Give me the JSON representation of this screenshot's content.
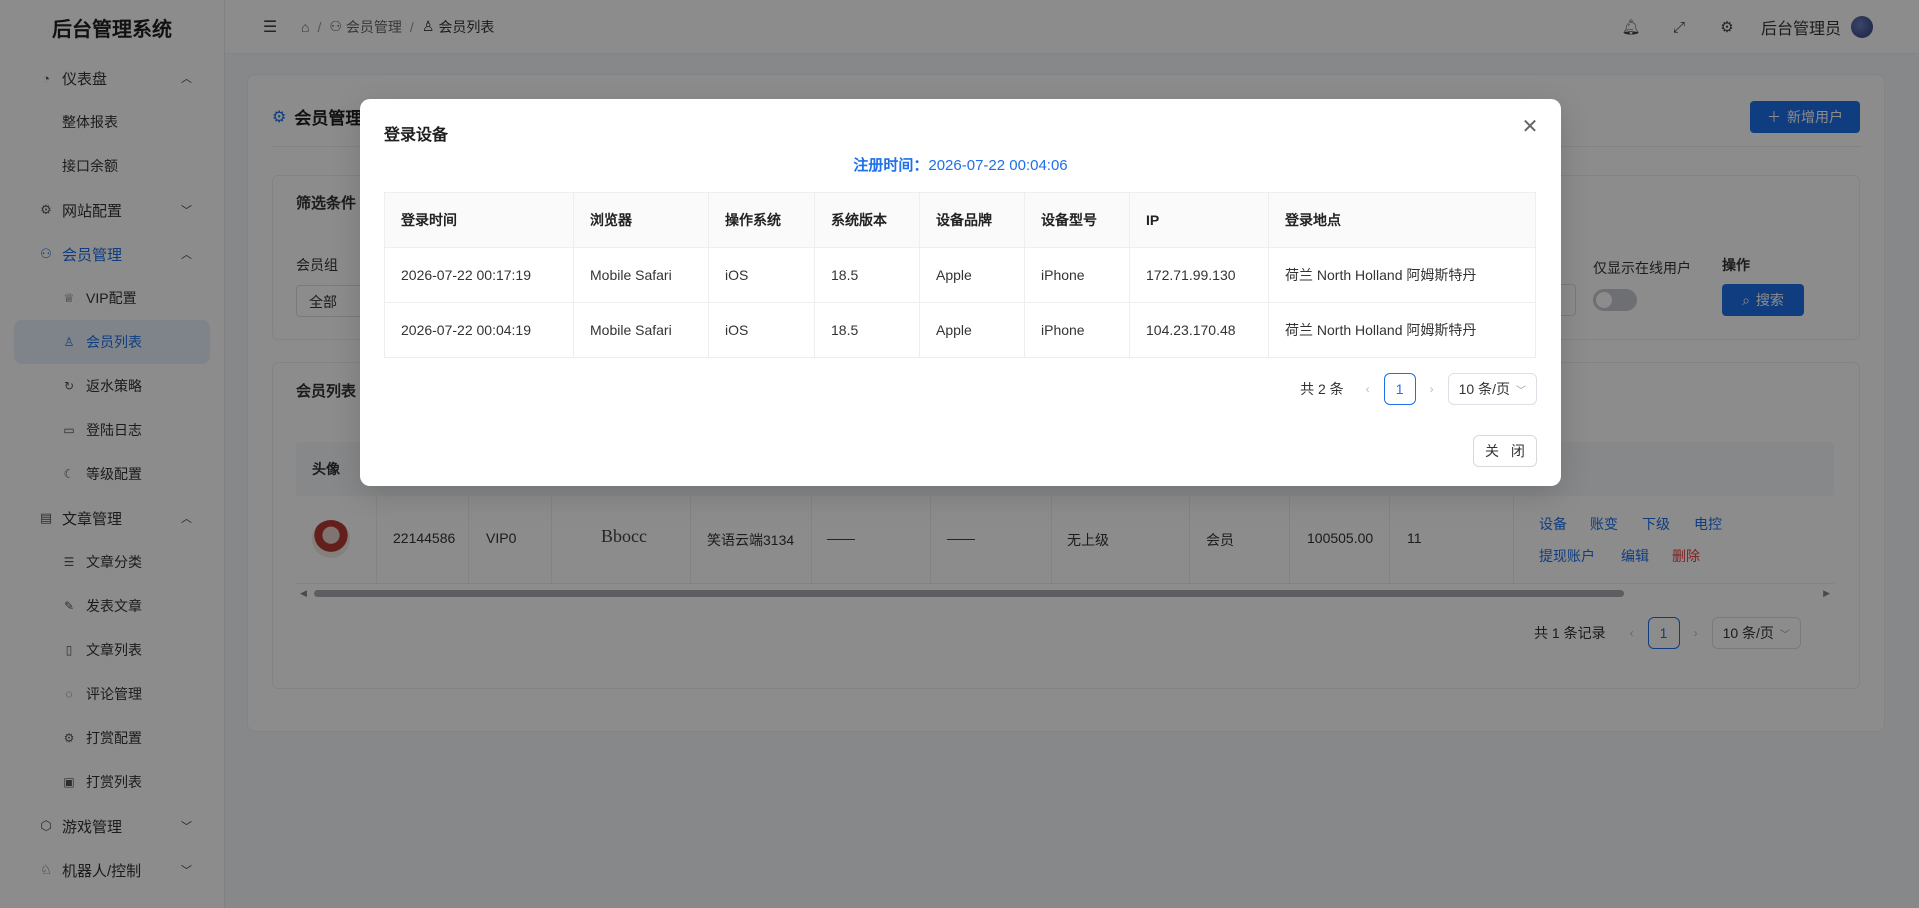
{
  "app": {
    "title": "后台管理系统"
  },
  "sidebar": {
    "groups": [
      {
        "label": "仪表盘",
        "icon": "dashboard-icon",
        "expanded": true,
        "items": [
          {
            "label": "整体报表"
          },
          {
            "label": "接口余额"
          }
        ]
      },
      {
        "label": "网站配置",
        "icon": "gear-icon",
        "expanded": false
      },
      {
        "label": "会员管理",
        "icon": "users-icon",
        "expanded": true,
        "active": true,
        "items": [
          {
            "label": "VIP配置",
            "icon": "crown-icon"
          },
          {
            "label": "会员列表",
            "icon": "user-icon",
            "active": true
          },
          {
            "label": "返水策略",
            "icon": "refresh-icon"
          },
          {
            "label": "登陆日志",
            "icon": "monitor-icon"
          },
          {
            "label": "等级配置",
            "icon": "moon-icon"
          }
        ]
      },
      {
        "label": "文章管理",
        "icon": "book-icon",
        "expanded": true,
        "items": [
          {
            "label": "文章分类",
            "icon": "list-icon"
          },
          {
            "label": "发表文章",
            "icon": "pen-icon"
          },
          {
            "label": "文章列表",
            "icon": "doc-icon"
          },
          {
            "label": "评论管理",
            "icon": "comment-icon"
          },
          {
            "label": "打赏配置",
            "icon": "gear-icon"
          },
          {
            "label": "打赏列表",
            "icon": "reward-icon"
          }
        ]
      },
      {
        "label": "游戏管理",
        "icon": "cube-icon",
        "expanded": false
      },
      {
        "label": "机器人/控制",
        "icon": "robot-icon",
        "expanded": false
      }
    ]
  },
  "header": {
    "breadcrumb": [
      {
        "label": ""
      },
      {
        "label": "会员管理"
      },
      {
        "label": "会员列表"
      }
    ],
    "admin_name": "后台管理员"
  },
  "page": {
    "title": "会员管理",
    "add_button": "新增用户",
    "filter": {
      "title": "筛选条件",
      "group_label": "会员组",
      "group_value": "全部",
      "online_label": "仅显示在线用户",
      "action_label": "操作",
      "search_button": "搜索"
    },
    "list": {
      "title": "会员列表",
      "header_first": "头像",
      "row": {
        "id": "22144586",
        "vip": "VIP0",
        "nickname": "Bbocc",
        "name": "笑语云端3134",
        "dash1": "——",
        "dash2": "——",
        "superior": "无上级",
        "role": "会员",
        "balance": "100505.00",
        "count": "11",
        "actions": [
          "设备",
          "账变",
          "下级",
          "电控",
          "提现账户",
          "编辑",
          "删除"
        ]
      },
      "pager": {
        "total": "共 1 条记录",
        "page": "1",
        "size": "10 条/页"
      }
    }
  },
  "modal": {
    "title": "登录设备",
    "reg_time_label": "注册时间：",
    "reg_time_value": "2026-07-22 00:04:06",
    "columns": [
      "登录时间",
      "浏览器",
      "操作系统",
      "系统版本",
      "设备品牌",
      "设备型号",
      "IP",
      "登录地点"
    ],
    "rows": [
      [
        "2026-07-22 00:17:19",
        "Mobile Safari",
        "iOS",
        "18.5",
        "Apple",
        "iPhone",
        "172.71.99.130",
        "荷兰 North Holland 阿姆斯特丹"
      ],
      [
        "2026-07-22 00:04:19",
        "Mobile Safari",
        "iOS",
        "18.5",
        "Apple",
        "iPhone",
        "104.23.170.48",
        "荷兰 North Holland 阿姆斯特丹"
      ]
    ],
    "pager": {
      "total": "共 2 条",
      "page": "1",
      "size": "10 条/页"
    },
    "close_button": "关 闭"
  },
  "colors": {
    "primary": "#1e6fe8",
    "danger": "#e53e3e"
  }
}
